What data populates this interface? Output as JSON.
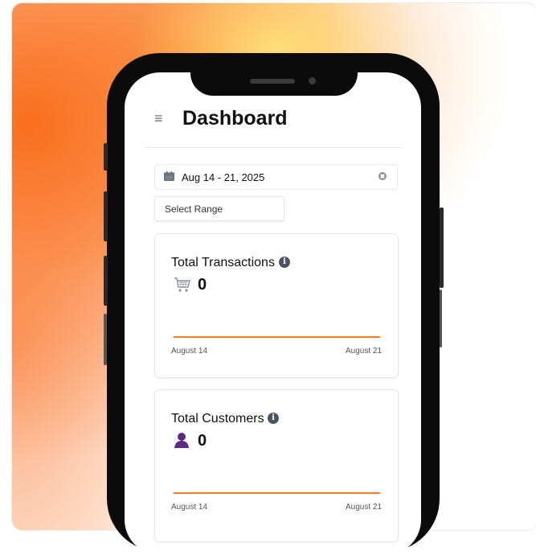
{
  "header": {
    "menu_icon": "hamburger-menu-icon",
    "title": "Dashboard"
  },
  "date_filter": {
    "value": "Aug 14 - 21, 2025",
    "icon": "calendar-icon",
    "clear_icon": "clear-icon"
  },
  "range_select": {
    "placeholder": "Select Range"
  },
  "cards": [
    {
      "title": "Total Transactions",
      "icon": "shopping-cart-icon",
      "value": "0",
      "start_label": "August 14",
      "end_label": "August 21",
      "line_color": "#f47b20"
    },
    {
      "title": "Total Customers",
      "icon": "user-icon",
      "value": "0",
      "start_label": "August 14",
      "end_label": "August 21",
      "line_color": "#f47b20"
    }
  ],
  "colors": {
    "accent": "#f47b20",
    "user_icon": "#5b2a86"
  }
}
